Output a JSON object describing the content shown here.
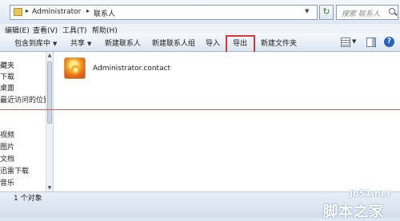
{
  "address_bar": {
    "breadcrumb": [
      "Administrator",
      "联系人"
    ],
    "search_placeholder": "搜索 联系人"
  },
  "menu": {
    "items": [
      "编辑(E)",
      "查看(V)",
      "工具(T)",
      "帮助(H)"
    ]
  },
  "toolbar": {
    "include_in_library": "包含到库中",
    "share": "共享",
    "new_contact": "新建联系人",
    "new_contact_group": "新建联系人组",
    "import": "导入",
    "export": "导出",
    "new_folder": "新建文件夹"
  },
  "nav_pane": {
    "items": [
      "藏夹",
      "下载",
      "桌面",
      "最近访问的位置",
      "视频",
      "图片",
      "文档",
      "迅雷下载",
      "音乐"
    ]
  },
  "content": {
    "file_name": "Administrator.contact"
  },
  "status": {
    "item_count": "1 个对象"
  },
  "watermark": {
    "site": "jb51.net",
    "logo": "脚本之家"
  },
  "colors": {
    "highlight_red": "#d8373a",
    "toolbar_bg": "#dbe6f3"
  }
}
